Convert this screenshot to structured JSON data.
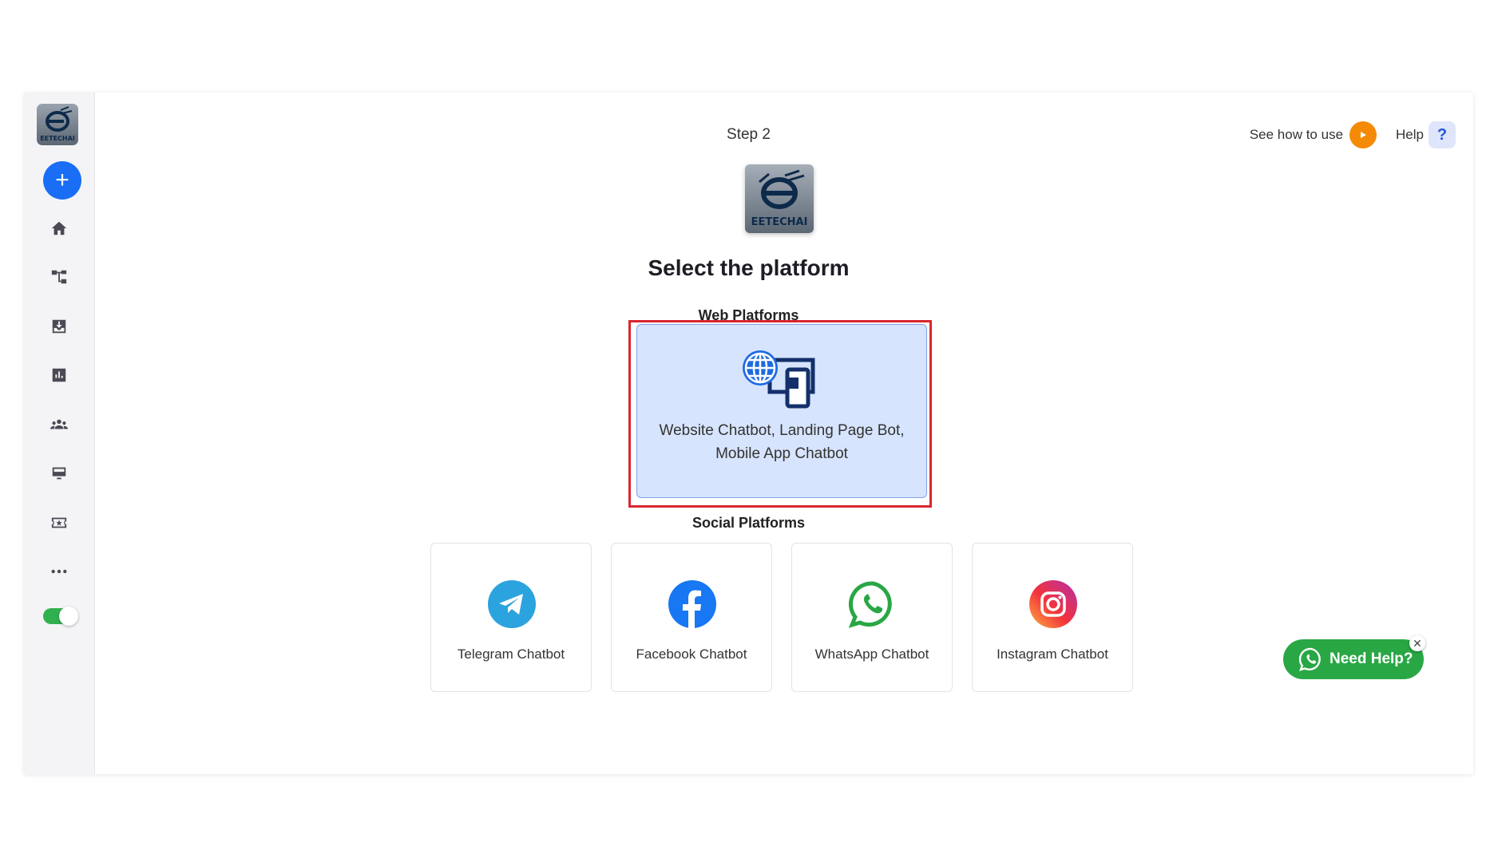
{
  "sidebar": {
    "logo_text": "EETECHAI",
    "add_label": "+",
    "items": [
      {
        "icon": "home-icon"
      },
      {
        "icon": "flow-icon"
      },
      {
        "icon": "inbox-icon"
      },
      {
        "icon": "analytics-icon"
      },
      {
        "icon": "users-icon"
      },
      {
        "icon": "monitor-icon"
      },
      {
        "icon": "ticket-icon"
      },
      {
        "icon": "more-icon"
      }
    ],
    "toggle_on": true
  },
  "header": {
    "see_how_label": "See how to use",
    "help_label": "Help",
    "help_icon": "?"
  },
  "main": {
    "step_label": "Step 2",
    "logo_text": "EETECHAI",
    "title": "Select the platform",
    "web_section_title": "Web Platforms",
    "web_card_label_line1": "Website Chatbot, Landing Page Bot,",
    "web_card_label_line2": "Mobile App Chatbot",
    "social_section_title": "Social Platforms",
    "social_cards": [
      {
        "label": "Telegram Chatbot",
        "icon": "telegram-icon"
      },
      {
        "label": "Facebook Chatbot",
        "icon": "facebook-icon"
      },
      {
        "label": "WhatsApp Chatbot",
        "icon": "whatsapp-icon"
      },
      {
        "label": "Instagram Chatbot",
        "icon": "instagram-icon"
      }
    ]
  },
  "need_help": {
    "label": "Need Help?",
    "close": "✕"
  },
  "colors": {
    "accent": "#1a6ef5",
    "highlight": "#d9262e",
    "whatsapp_green": "#29a745",
    "orange": "#f58a07"
  }
}
